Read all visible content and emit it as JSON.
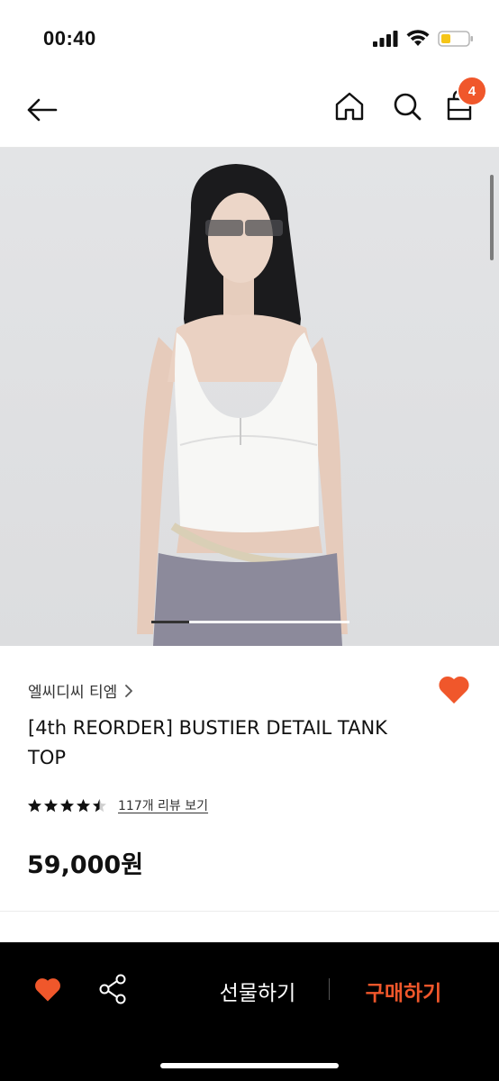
{
  "status_bar": {
    "time": "00:40"
  },
  "nav": {
    "cart_count": "4"
  },
  "product": {
    "brand": "엘씨디씨 티엠",
    "title": "[4th REORDER] BUSTIER DETAIL TANK TOP",
    "rating": 4.5,
    "reviews_label": "117개 리뷰 보기",
    "price": "59,000원",
    "image_progress": 0.19
  },
  "bottom_bar": {
    "gift_label": "선물하기",
    "buy_label": "구매하기"
  },
  "colors": {
    "accent": "#f0572b",
    "bar_bg": "#000000"
  },
  "icons": [
    "back-arrow-icon",
    "home-icon",
    "search-icon",
    "shopping-bag-icon",
    "heart-icon",
    "share-icon",
    "star-icon",
    "chevron-right-icon"
  ]
}
